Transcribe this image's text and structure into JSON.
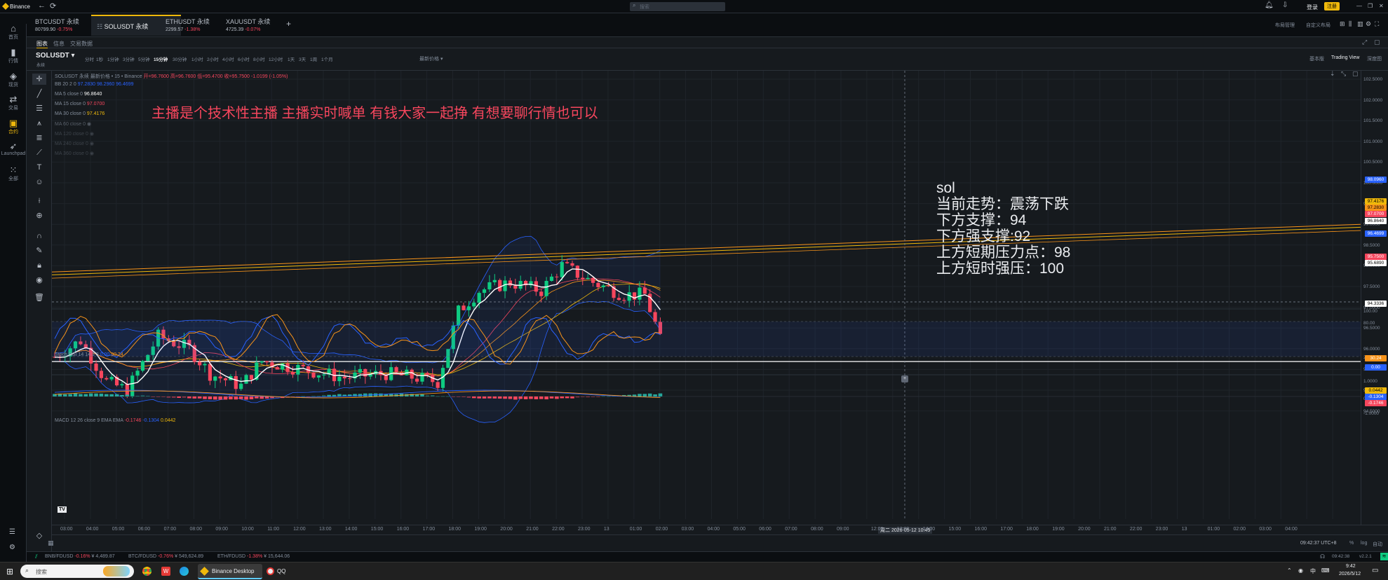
{
  "window": {
    "logo": "Binance",
    "search_placeholder": "搜索",
    "login": "登录",
    "register": "注册",
    "controls": [
      "—",
      "❐",
      "✕"
    ]
  },
  "tabs": [
    {
      "name": "BTCUSDT 永续",
      "price": "80799.90",
      "change": "-0.75%"
    },
    {
      "name": "SOLUSDT 永续",
      "price": "",
      "change": ""
    },
    {
      "name": "ETHUSDT 永续",
      "price": "2299.57",
      "change": "-1.38%"
    },
    {
      "name": "XAUUSDT 永续",
      "price": "4725.39",
      "change": "-0.07%"
    }
  ],
  "tab_add": "+",
  "top_right": {
    "layout": "布局管理",
    "custom_layout": "自定义布局"
  },
  "leftnav": [
    {
      "icon": "home-icon",
      "label": "首页"
    },
    {
      "icon": "market-icon",
      "label": "行情"
    },
    {
      "icon": "spot-icon",
      "label": "现货"
    },
    {
      "icon": "trade-icon",
      "label": "交易"
    },
    {
      "icon": "futures-icon",
      "label": "合约"
    },
    {
      "icon": "rocket-icon",
      "label": "Launchpad"
    },
    {
      "icon": "apps-icon",
      "label": "全部"
    }
  ],
  "subtabs": [
    "图表",
    "信息",
    "交易数据"
  ],
  "toolbar": {
    "symbol": "SOLUSDT",
    "symbol_sub": "永续",
    "intervals": [
      "分时",
      "1秒",
      "1分钟",
      "3分钟",
      "5分钟",
      "15分钟",
      "30分钟",
      "1小时",
      "2小时",
      "4小时",
      "6小时",
      "8小时",
      "12小时",
      "1天",
      "3天",
      "1周",
      "1个月"
    ],
    "active_interval": "15分钟",
    "price_type": "最新价格",
    "views": [
      "基本版",
      "Trading View",
      "深度图"
    ]
  },
  "legend": {
    "header": "SOLUSDT 永续 最新价格 • 15 • Binance",
    "ohlc": "开=96.7600 高=96.7600 低=95.4700 收=95.7500 -1.0199 (-1.05%)",
    "rows": [
      {
        "name": "BB 20 2 0",
        "value": "97.2830 98.2960 96.4699"
      },
      {
        "name": "MA 5 close 0",
        "value": "96.8640"
      },
      {
        "name": "MA 15 close 0",
        "value": "97.0700"
      },
      {
        "name": "MA 30 close 0",
        "value": "97.4176"
      },
      {
        "name": "MA 60 close 0",
        "value": ""
      },
      {
        "name": "MA 120 close 0",
        "value": ""
      },
      {
        "name": "MA 240 close 0",
        "value": ""
      },
      {
        "name": "MA 360 close 0",
        "value": ""
      }
    ],
    "stoch": {
      "name": "Stoch RSI 14 14 3 3",
      "k": "0.00",
      "d": "30.24"
    },
    "macd": {
      "name": "MACD 12 26 close 9 EMA EMA",
      "v1": "-0.1746",
      "v2": "-0.1304",
      "v3": "0.0442"
    }
  },
  "annotations": {
    "headline": "主播是个技术性主播 主播实时喊单 有钱大家一起挣 有想要聊行情也可以",
    "analysis": [
      "sol",
      "当前走势：震荡下跌",
      "下方支撑：94",
      "下方强支撑:92",
      "上方短期压力点：98",
      "上方短时强压：100"
    ]
  },
  "price_axis": {
    "ticks": [
      "102.5000",
      "102.0000",
      "101.5000",
      "101.0000",
      "100.5000",
      "100.0000",
      "99.5000",
      "99.0000",
      "98.5000",
      "98.0000",
      "97.5000",
      "97.0000",
      "96.5000",
      "96.0000",
      "95.5000",
      "95.0000",
      "94.5000"
    ],
    "labels": [
      {
        "text": "98.0960",
        "color": "#2962ff"
      },
      {
        "text": "97.4176",
        "color": "#f0b90b"
      },
      {
        "text": "97.2830",
        "color": "#f7931a"
      },
      {
        "text": "97.0700",
        "color": "#f6465d"
      },
      {
        "text": "96.8640",
        "color": "#ffffff"
      },
      {
        "text": "96.4699",
        "color": "#2962ff"
      },
      {
        "text": "95.7500",
        "color": "#f6465d"
      },
      {
        "text": "95.6890",
        "color": "#ffffff"
      },
      {
        "text": "94.3336",
        "color": "#ffffff"
      }
    ],
    "stoch_ticks": [
      "100.00",
      "80.00",
      "20.00"
    ],
    "stoch_labels": [
      {
        "text": "30.24",
        "color": "#f7931a"
      },
      {
        "text": "0.00",
        "color": "#2962ff"
      }
    ],
    "macd_ticks": [
      "1.0000",
      "0.0000",
      "-1.0000"
    ],
    "macd_labels": [
      {
        "text": "0.0442",
        "color": "#f0b90b"
      },
      {
        "text": "-0.1304",
        "color": "#2962ff"
      },
      {
        "text": "-0.1746",
        "color": "#f6465d"
      }
    ]
  },
  "time_axis": [
    "03:00",
    "04:00",
    "05:00",
    "06:00",
    "07:00",
    "08:00",
    "09:00",
    "10:00",
    "11:00",
    "12:00",
    "13:00",
    "14:00",
    "15:00",
    "16:00",
    "17:00",
    "18:00",
    "19:00",
    "20:00",
    "21:00",
    "22:00",
    "23:00",
    "13",
    "01:00",
    "02:00",
    "03:00",
    "04:00",
    "05:00",
    "06:00",
    "07:00",
    "08:00",
    "09:00",
    "周二 2026-05-12 10:45",
    "12:00",
    "13:00",
    "14:00",
    "15:00",
    "16:00",
    "17:00",
    "18:00",
    "19:00",
    "20:00",
    "21:00",
    "22:00",
    "23:00",
    "13",
    "01:00",
    "02:00",
    "03:00",
    "04:00"
  ],
  "footer": {
    "time": "09:42:37 UTC+8",
    "pct": "%",
    "log": "log",
    "auto": "自动"
  },
  "tickers": [
    {
      "pair": "BNB/FDUSD",
      "change": "-0.16%",
      "price": "¥ 4,489.87"
    },
    {
      "pair": "BTC/FDUSD",
      "change": "-0.76%",
      "price": "¥ 549,624.89"
    },
    {
      "pair": "ETH/FDUSD",
      "change": "-1.38%",
      "price": "¥ 15,644.06"
    }
  ],
  "ticker_right": {
    "time": "09:42:38",
    "version": "v2.2.1"
  },
  "taskbar": {
    "search": "搜索",
    "apps": [
      "Binance Desktop",
      "QQ"
    ],
    "clock": "9:42",
    "date": "2026/5/12",
    "lang": "中"
  }
}
